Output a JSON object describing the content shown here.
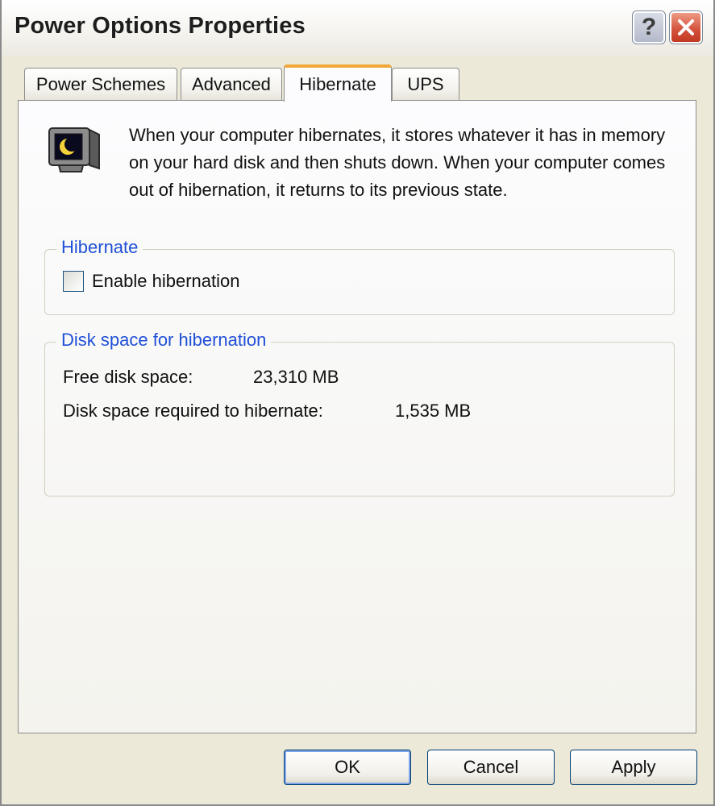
{
  "window": {
    "title": "Power Options Properties",
    "help_label": "?"
  },
  "tabs": [
    {
      "label": "Power Schemes",
      "active": false
    },
    {
      "label": "Advanced",
      "active": false
    },
    {
      "label": "Hibernate",
      "active": true
    },
    {
      "label": "UPS",
      "active": false
    }
  ],
  "hibernate_tab": {
    "description": "When your computer hibernates, it stores whatever it has in memory on your hard disk and then shuts down. When your computer comes out of hibernation, it returns to its previous state.",
    "hibernate_group": {
      "legend": "Hibernate",
      "enable_label": "Enable hibernation",
      "enable_checked": false
    },
    "disk_group": {
      "legend": "Disk space for hibernation",
      "free_label": "Free disk space:",
      "free_value": "23,310 MB",
      "required_label": "Disk space required to hibernate:",
      "required_value": "1,535 MB"
    }
  },
  "buttons": {
    "ok": "OK",
    "cancel": "Cancel",
    "apply": "Apply"
  },
  "icons": {
    "intro": "hibernate-monitor-icon",
    "help": "help-icon",
    "close": "close-icon"
  },
  "colors": {
    "accent_tab": "#f0a83a",
    "group_legend": "#2050d8",
    "close_button": "#d3503a"
  }
}
